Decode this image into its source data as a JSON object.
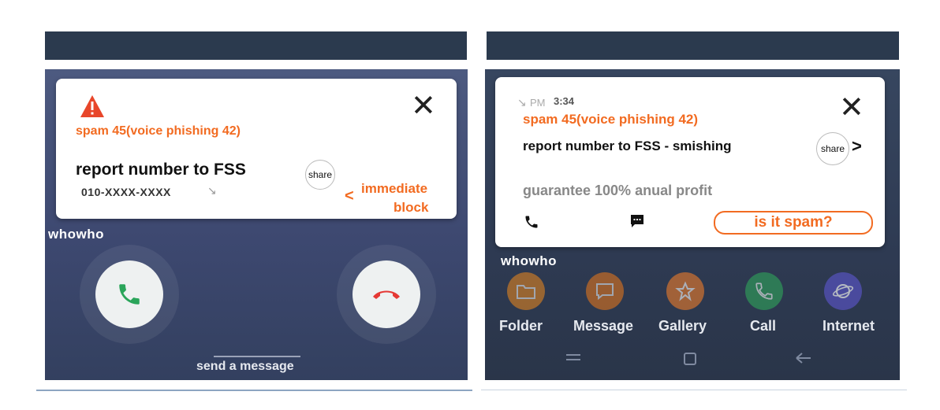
{
  "left": {
    "card": {
      "spam_line": "spam 45(voice phishing 42)",
      "report_text": "report number to FSS",
      "share_label": "share",
      "phone_number": "010-XXXX-XXXX",
      "arrow_glyph": "↘",
      "block_chevron": "<",
      "block_line1": "immediate",
      "block_line2": "block"
    },
    "brand": "whowho",
    "send_message": "send a message",
    "icons": [
      "warning-icon",
      "close-icon",
      "accept-call-icon",
      "decline-call-icon"
    ]
  },
  "right": {
    "card": {
      "arrow_glyph": "↘",
      "ampm": "PM",
      "time": "3:34",
      "spam_line": "spam 45(voice phishing 42)",
      "report_text": "report number to FSS - smishing",
      "share_label": "share",
      "chevron": ">",
      "message_text": "guarantee 100% anual profit",
      "spam_question": "is it spam?"
    },
    "brand": "whowho",
    "apps": [
      {
        "label": "Folder",
        "color": "#f08a1c",
        "icon": "folder-icon"
      },
      {
        "label": "Message",
        "color": "#f07a18",
        "icon": "message-icon"
      },
      {
        "label": "Gallery",
        "color": "#ee7d2a",
        "icon": "gallery-icon"
      },
      {
        "label": "Call",
        "color": "#2fa65a",
        "icon": "phone-icon"
      },
      {
        "label": "Internet",
        "color": "#5a55c8",
        "icon": "internet-icon"
      }
    ],
    "nav": [
      "recent-apps-icon",
      "home-icon",
      "back-icon"
    ]
  },
  "colors": {
    "accent": "#f26b21",
    "header_bar": "#2b3a4e",
    "accept_green": "#2aa55a",
    "decline_red": "#e53935"
  }
}
